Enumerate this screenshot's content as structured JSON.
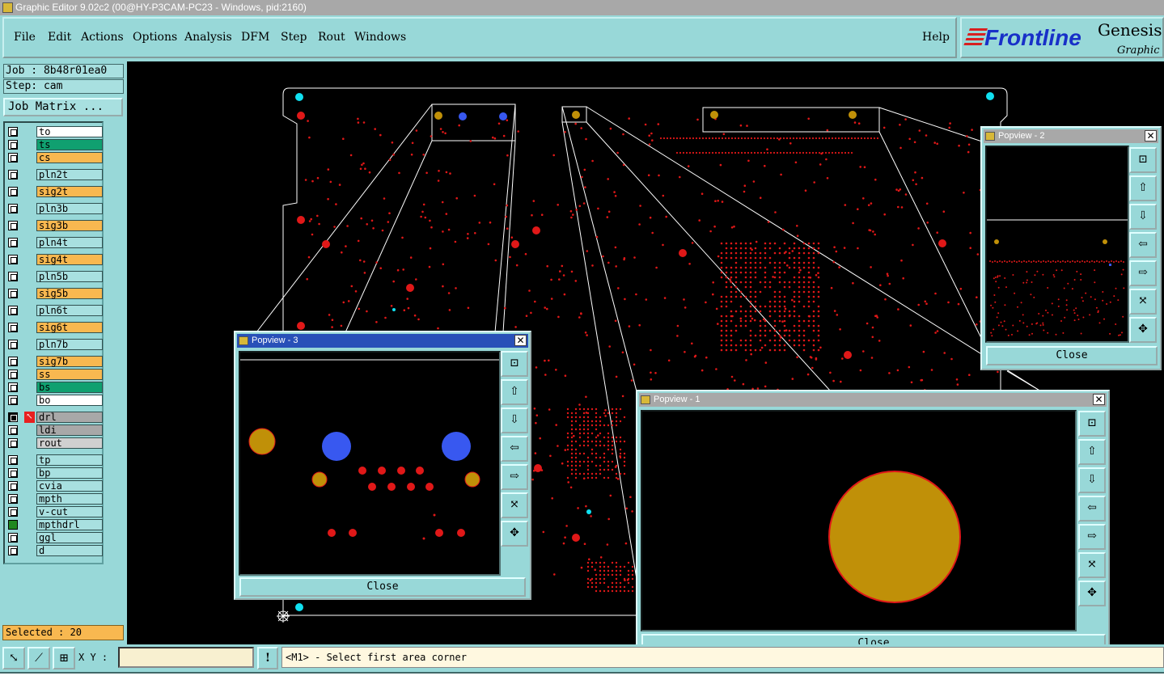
{
  "window": {
    "title": "Graphic Editor 9.02c2 (00@HY-P3CAM-PC23 - Windows, pid:2160)"
  },
  "menu": {
    "items": [
      "File",
      "Edit",
      "Actions",
      "Options",
      "Analysis",
      "DFM",
      "Step",
      "Rout",
      "Windows"
    ],
    "help": "Help"
  },
  "brand": {
    "logo": "Frontline",
    "product": "Genesis",
    "subtitle": "Graphic E"
  },
  "job": {
    "label": "Job : 8b48r01ea0",
    "step": "Step: cam",
    "matrix_button": "Job Matrix ..."
  },
  "layers": [
    {
      "name": "to",
      "color": "#ffffff"
    },
    {
      "name": "ts",
      "color": "#10a070"
    },
    {
      "name": "cs",
      "color": "#f8b850"
    },
    {
      "name": "pln2t",
      "color": "#a8e0e0"
    },
    {
      "name": "sig2t",
      "color": "#f8b850"
    },
    {
      "name": "pln3b",
      "color": "#a8e0e0"
    },
    {
      "name": "sig3b",
      "color": "#f8b850"
    },
    {
      "name": "pln4t",
      "color": "#a8e0e0"
    },
    {
      "name": "sig4t",
      "color": "#f8b850"
    },
    {
      "name": "pln5b",
      "color": "#a8e0e0"
    },
    {
      "name": "sig5b",
      "color": "#f8b850"
    },
    {
      "name": "pln6t",
      "color": "#a8e0e0"
    },
    {
      "name": "sig6t",
      "color": "#f8b850"
    },
    {
      "name": "pln7b",
      "color": "#a8e0e0"
    },
    {
      "name": "sig7b",
      "color": "#f8b850"
    },
    {
      "name": "ss",
      "color": "#f8b850"
    },
    {
      "name": "bs",
      "color": "#10a070"
    },
    {
      "name": "bo",
      "color": "#ffffff"
    },
    {
      "name": "drl",
      "color": "#a8a8a8"
    },
    {
      "name": "ldi",
      "color": "#a8a8a8"
    },
    {
      "name": "rout",
      "color": "#d0d0d0"
    },
    {
      "name": "tp",
      "color": "#a8e0e0"
    },
    {
      "name": "bp",
      "color": "#a8e0e0"
    },
    {
      "name": "cvia",
      "color": "#a8e0e0"
    },
    {
      "name": "mpth",
      "color": "#a8e0e0"
    },
    {
      "name": "v-cut",
      "color": "#a8e0e0"
    },
    {
      "name": "mpthdrl",
      "color": "#a8e0e0"
    },
    {
      "name": "ggl",
      "color": "#a8e0e0"
    },
    {
      "name": "d",
      "color": "#a8e0e0"
    }
  ],
  "selected": "Selected : 20",
  "status": {
    "xy_label": "X Y :",
    "xy_value": "",
    "message": "<M1> - Select first area corner",
    "warn": "!"
  },
  "popviews": {
    "p1": {
      "title": "Popview - 1",
      "close": "Close"
    },
    "p2": {
      "title": "Popview - 2",
      "close": "Close"
    },
    "p3": {
      "title": "Popview - 3",
      "close": "Close"
    }
  },
  "colors": {
    "pad_red": "#e01818",
    "pad_gold": "#c09008",
    "pad_blue": "#3858f0",
    "pad_cyan": "#10e0f0",
    "canvas": "#000000"
  }
}
